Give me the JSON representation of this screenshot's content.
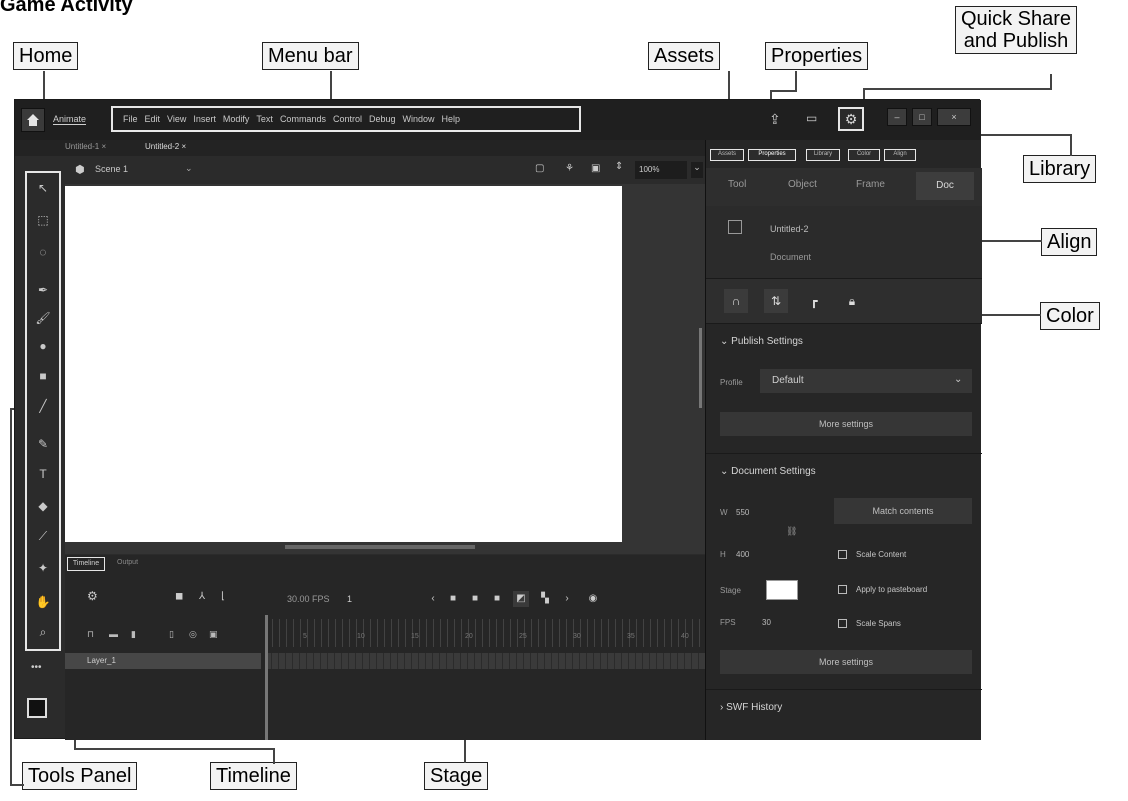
{
  "heading": "Game Activity",
  "callouts": {
    "home": "Home",
    "menu_bar": "Menu bar",
    "assets": "Assets",
    "properties": "Properties",
    "quick_share_line1": "Quick Share",
    "quick_share_line2": "and Publish",
    "library": "Library",
    "align": "Align",
    "color": "Color",
    "tools_panel": "Tools Panel",
    "timeline": "Timeline",
    "stage": "Stage"
  },
  "app": {
    "name": "Animate",
    "menu": [
      "File",
      "Edit",
      "View",
      "Insert",
      "Modify",
      "Text",
      "Commands",
      "Control",
      "Debug",
      "Window",
      "Help"
    ],
    "doc_tabs": [
      "Untitled-1 ×",
      "Untitled-2 ×"
    ],
    "scene": "Scene 1",
    "zoom": "100%",
    "window_controls": [
      "–",
      "□",
      "×"
    ]
  },
  "timeline": {
    "tab": "Timeline",
    "output_tab": "Output",
    "fps": "30.00 FPS",
    "frame": "1",
    "layer": "Layer_1",
    "ruler": [
      "5",
      "10",
      "15",
      "20",
      "25",
      "30",
      "35",
      "40"
    ]
  },
  "panel": {
    "tabs": [
      "Assets",
      "Properties",
      "Library",
      "Color",
      "Align"
    ],
    "object_tabs": [
      "Tool",
      "Object",
      "Frame",
      "Doc"
    ],
    "doc_name": "Untitled-2",
    "doc_type": "Document",
    "publish_header": "Publish Settings",
    "profile_label": "Profile",
    "profile_value": "Default",
    "more_settings": "More settings",
    "document_header": "Document Settings",
    "w_label": "W",
    "w_value": "550",
    "h_label": "H",
    "h_value": "400",
    "stage_label": "Stage",
    "fps_label": "FPS",
    "fps_value": "30",
    "match_contents": "Match contents",
    "scale_content": "Scale Content",
    "apply_pasteboard": "Apply to pasteboard",
    "scale_spans": "Scale Spans",
    "more_settings2": "More settings",
    "swf_history": "SWF History"
  },
  "colors": {
    "app_bg": "#2b2b2b",
    "stage": "#ffffff",
    "highlight": "#e6e6e6"
  }
}
